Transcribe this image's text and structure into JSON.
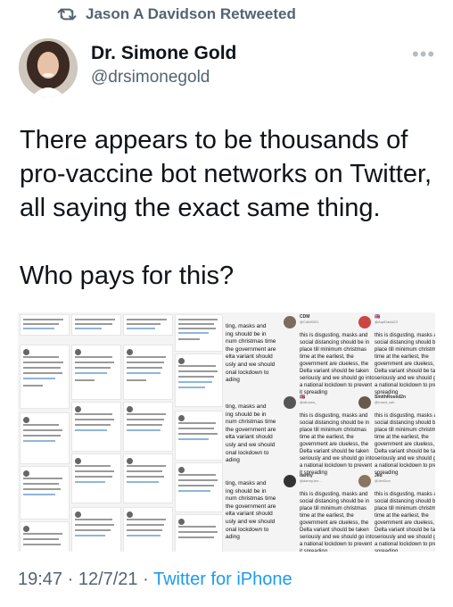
{
  "header": {
    "retweeted_by": "Jason A Davidson Retweeted"
  },
  "author": {
    "name": "Dr. Simone Gold",
    "handle": "@drsimonegold"
  },
  "tweet": {
    "lines": [
      "There appears to be thousands of",
      "pro-vaccine bot networks on Twitter,",
      "all saying the exact same thing.",
      "Who pays for this?"
    ]
  },
  "media": {
    "bot_message": "this is disgusting, masks and social distancing should be in place till minimum christmas time at the earliest, the government are clueless, the Delta variant should be taken seriously and we should go into a national lockdown to prevent it spreading",
    "partial_lines": [
      "ting, masks and",
      "ing should be in",
      "num christmas time",
      "the government are",
      "elta variant should",
      "usly and we should",
      "onal lockdown to",
      "ading"
    ],
    "tweets": [
      {
        "name": "CDM",
        "handle": "@CdM8321"
      },
      {
        "name": "",
        "handle": "@AqeDavid23"
      },
      {
        "name": "",
        "handle": "@sfruzen_"
      },
      {
        "name": "SmithRosed2n",
        "handle": "@rosed_ssh"
      },
      {
        "name": "danny",
        "handle": "@danny1ex..."
      },
      {
        "name": "Jed",
        "handle": "@JedDon"
      }
    ]
  },
  "footer": {
    "time": "19:47 · 12/7/21 · ",
    "source": "Twitter for iPhone"
  },
  "icons": {
    "retweet": "retweet-icon",
    "more": "more-icon"
  },
  "colors": {
    "secondary_text": "#536471",
    "link": "#1d9bf0"
  }
}
